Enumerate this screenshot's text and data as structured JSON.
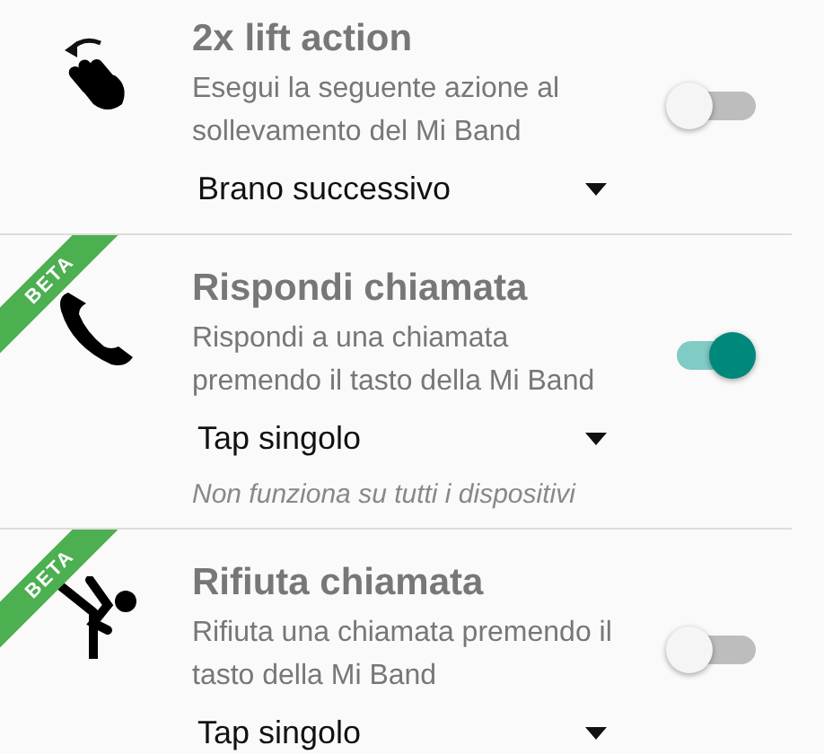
{
  "items": [
    {
      "kind": "hand",
      "title": "2x lift action",
      "description": "Esegui la seguente azione al sollevamento del Mi Band",
      "on": false,
      "dropdown": {
        "value": "Brano successivo"
      }
    },
    {
      "kind": "phone",
      "badge": "BETA",
      "title": "Rispondi chiamata",
      "description": "Rispondi a una chiamata premendo il tasto della Mi Band",
      "on": true,
      "dropdown": {
        "value": "Tap singolo"
      },
      "note": "Non funziona su tutti i dispositivi"
    },
    {
      "kind": "kick",
      "badge": "BETA",
      "title": "Rifiuta chiamata",
      "description": "Rifiuta una chiamata premendo il tasto della Mi Band",
      "on": false,
      "dropdown": {
        "value": "Tap singolo"
      }
    }
  ]
}
